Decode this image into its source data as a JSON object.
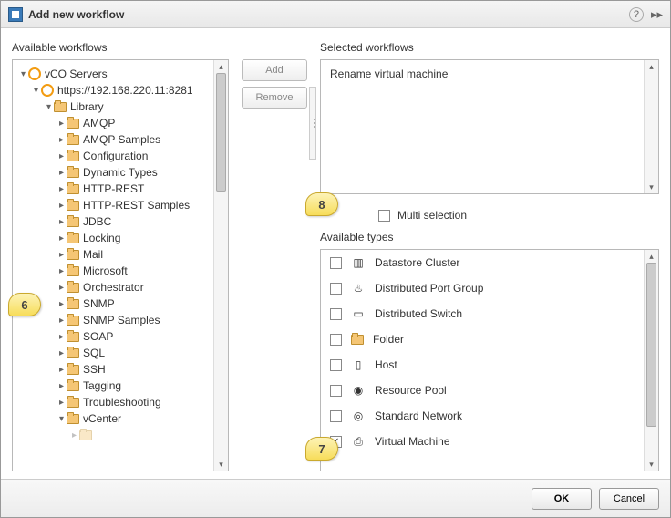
{
  "title": "Add new workflow",
  "left_label": "Available workflows",
  "right_label": "Selected workflows",
  "types_label": "Available types",
  "multi_label": "Multi selection",
  "add_btn": "Add",
  "remove_btn": "Remove",
  "ok_btn": "OK",
  "cancel_btn": "Cancel",
  "tree": {
    "root": "vCO Servers",
    "server": "https://192.168.220.11:8281",
    "library": "Library",
    "items": [
      "AMQP",
      "AMQP Samples",
      "Configuration",
      "Dynamic Types",
      "HTTP-REST",
      "HTTP-REST Samples",
      "JDBC",
      "Locking",
      "Mail",
      "Microsoft",
      "Orchestrator",
      "SNMP",
      "SNMP Samples",
      "SOAP",
      "SQL",
      "SSH",
      "Tagging",
      "Troubleshooting",
      "vCenter"
    ]
  },
  "selected": [
    "Rename virtual machine"
  ],
  "types": [
    {
      "label": "Datastore Cluster",
      "checked": false,
      "icon": "▥"
    },
    {
      "label": "Distributed Port Group",
      "checked": false,
      "icon": "♨"
    },
    {
      "label": "Distributed Switch",
      "checked": false,
      "icon": "▭"
    },
    {
      "label": "Folder",
      "checked": false,
      "icon": "folder"
    },
    {
      "label": "Host",
      "checked": false,
      "icon": "▯"
    },
    {
      "label": "Resource Pool",
      "checked": false,
      "icon": "◉"
    },
    {
      "label": "Standard Network",
      "checked": false,
      "icon": "◎"
    },
    {
      "label": "Virtual Machine",
      "checked": true,
      "icon": "⎙"
    }
  ],
  "callouts": {
    "c6": "6",
    "c7": "7",
    "c8": "8"
  }
}
